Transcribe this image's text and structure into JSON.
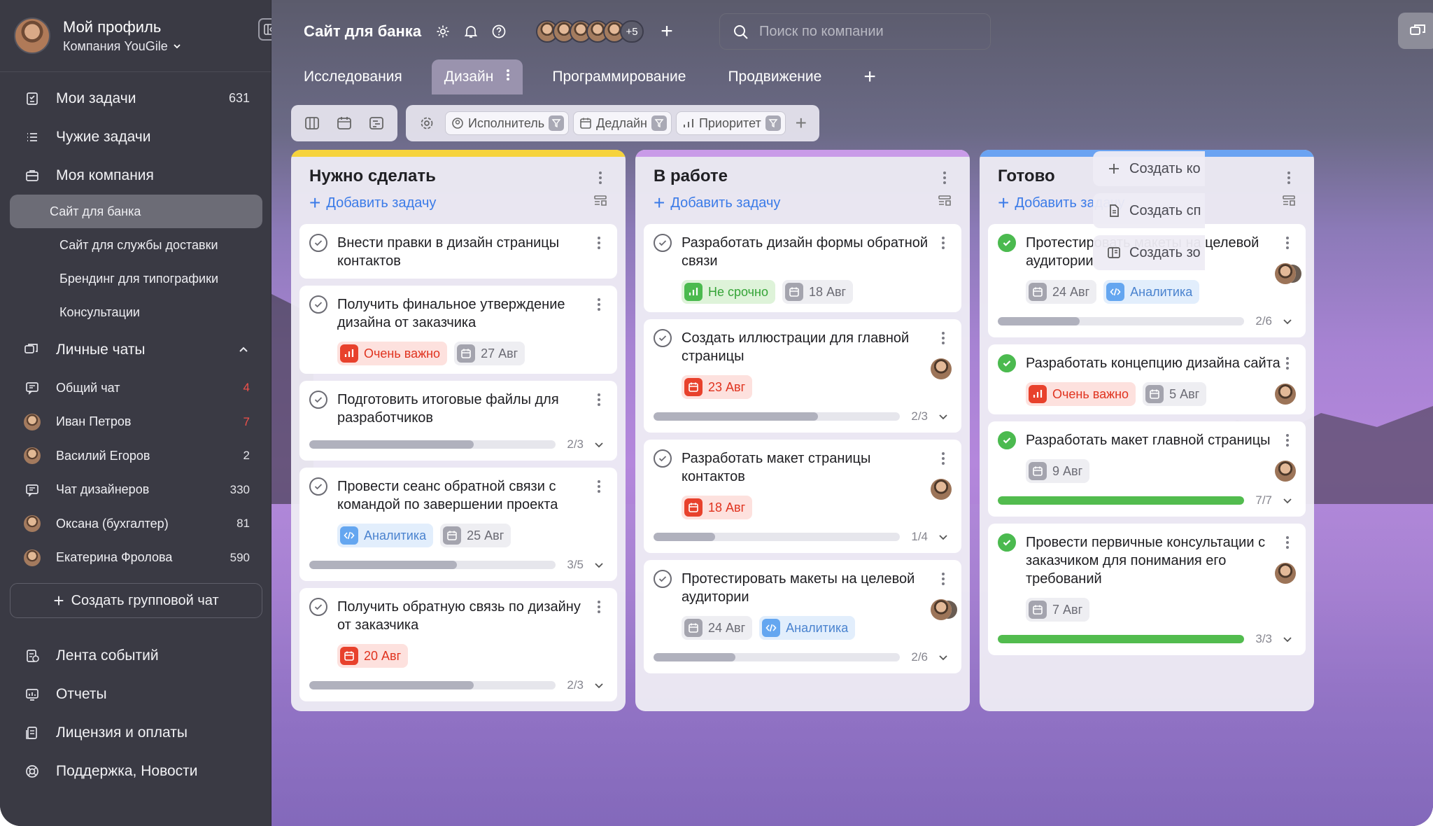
{
  "profile": {
    "name": "Мой профиль",
    "company": "Компания YouGile"
  },
  "nav": [
    {
      "label": "Мои задачи",
      "count": "631",
      "icon": "my-tasks-icon"
    },
    {
      "label": "Чужие задачи",
      "count": "",
      "icon": "list-icon"
    },
    {
      "label": "Моя компания",
      "count": "",
      "icon": "briefcase-icon"
    }
  ],
  "projects": [
    {
      "label": "Сайт для банка",
      "active": true
    },
    {
      "label": "Сайт для службы доставки"
    },
    {
      "label": "Брендинг для типографики"
    },
    {
      "label": "Консультации"
    }
  ],
  "chats_title": "Личные чаты",
  "chats": [
    {
      "label": "Общий чат",
      "count": "4",
      "red": true,
      "type": "chat"
    },
    {
      "label": "Иван Петров",
      "count": "7",
      "red": true,
      "type": "avatar"
    },
    {
      "label": "Василий Егоров",
      "count": "2",
      "type": "avatar"
    },
    {
      "label": "Чат дизайнеров",
      "count": "330",
      "type": "chat"
    },
    {
      "label": "Оксана (бухгалтер)",
      "count": "81",
      "type": "avatar"
    },
    {
      "label": "Екатерина Фролова",
      "count": "590",
      "type": "avatar"
    }
  ],
  "create_group": "Создать групповой чат",
  "bottom_nav": [
    {
      "label": "Лента событий",
      "icon": "events-icon"
    },
    {
      "label": "Отчеты",
      "icon": "reports-icon"
    },
    {
      "label": "Лицензия и оплаты",
      "icon": "license-icon"
    },
    {
      "label": "Поддержка, Новости",
      "icon": "support-icon"
    }
  ],
  "header": {
    "project_title": "Сайт для банка",
    "more_members": "+5",
    "search_placeholder": "Поиск по компании"
  },
  "tabs": [
    "Исследования",
    "Дизайн",
    "Программирование",
    "Продвижение"
  ],
  "filters": [
    "Исполнитель",
    "Дедлайн",
    "Приоритет"
  ],
  "add_task_label": "Добавить задачу",
  "columns": [
    {
      "title": "Нужно сделать",
      "stripe": "#f6d33c",
      "cards": [
        {
          "title": "Внести правки в дизайн страницы контактов",
          "done": false,
          "tags": [],
          "progress": null
        },
        {
          "title": "Получить финальное утверждение дизайна от заказчика",
          "done": false,
          "tags": [
            {
              "kind": "red",
              "icon": "priority-icon",
              "text": "Очень важно"
            },
            {
              "kind": "gray",
              "icon": "calendar-icon",
              "text": "27 Авг"
            }
          ],
          "progress": null
        },
        {
          "title": "Подготовить итоговые файлы для разработчиков",
          "done": false,
          "tags": [],
          "progress": {
            "text": "2/3",
            "value": 0.667
          }
        },
        {
          "title": "Провести сеанс обратной связи с командой по завершении проекта",
          "done": false,
          "tags": [
            {
              "kind": "blue",
              "icon": "code-icon",
              "text": "Аналитика"
            },
            {
              "kind": "gray",
              "icon": "calendar-icon",
              "text": "25 Авг"
            }
          ],
          "progress": {
            "text": "3/5",
            "value": 0.6
          }
        },
        {
          "title": "Получить обратную связь по дизайну от заказчика",
          "done": false,
          "tags": [
            {
              "kind": "red",
              "icon": "calendar-icon",
              "text": "20 Авг"
            }
          ],
          "progress": {
            "text": "2/3",
            "value": 0.667
          }
        }
      ]
    },
    {
      "title": "В работе",
      "stripe": "#c99be8",
      "cards": [
        {
          "title": "Разработать дизайн формы обратной связи",
          "done": false,
          "tags": [
            {
              "kind": "green",
              "icon": "priority-icon",
              "text": "Не срочно"
            },
            {
              "kind": "gray",
              "icon": "calendar-icon",
              "text": "18 Авг"
            }
          ],
          "progress": null
        },
        {
          "title": "Создать иллюстрации для главной страницы",
          "done": false,
          "tags": [
            {
              "kind": "red",
              "icon": "calendar-icon",
              "text": "23 Авг"
            }
          ],
          "avatar": true,
          "progress": {
            "text": "2/3",
            "value": 0.667
          }
        },
        {
          "title": "Разработать макет страницы контактов",
          "done": false,
          "tags": [
            {
              "kind": "red",
              "icon": "calendar-icon",
              "text": "18 Авг"
            }
          ],
          "avatar": true,
          "progress": {
            "text": "1/4",
            "value": 0.25
          }
        },
        {
          "title": "Протестировать макеты на целевой аудитории",
          "done": false,
          "tags": [
            {
              "kind": "gray",
              "icon": "calendar-icon",
              "text": "24 Авг"
            },
            {
              "kind": "blue",
              "icon": "code-icon",
              "text": "Аналитика"
            }
          ],
          "avatar": true,
          "duo": true,
          "progress": {
            "text": "2/6",
            "value": 0.333
          }
        }
      ]
    },
    {
      "title": "Готово",
      "stripe": "#6aa3f2",
      "cards": [
        {
          "title": "Протестировать макеты на целевой аудитории",
          "done": true,
          "tags": [
            {
              "kind": "gray",
              "icon": "calendar-icon",
              "text": "24 Авг"
            },
            {
              "kind": "blue",
              "icon": "code-icon",
              "text": "Аналитика"
            }
          ],
          "avatar": true,
          "duo": true,
          "progress": {
            "text": "2/6",
            "value": 0.333
          }
        },
        {
          "title": "Разработать концепцию дизайна сайта",
          "done": true,
          "tags": [
            {
              "kind": "red",
              "icon": "priority-icon",
              "text": "Очень важно"
            },
            {
              "kind": "gray",
              "icon": "calendar-icon",
              "text": "5 Авг"
            }
          ],
          "avatar": true,
          "progress": null
        },
        {
          "title": "Разработать макет главной страницы",
          "done": true,
          "tags": [
            {
              "kind": "gray",
              "icon": "calendar-icon",
              "text": "9 Авг"
            }
          ],
          "avatar": true,
          "progress": {
            "text": "7/7",
            "value": 1.0,
            "green": true
          }
        },
        {
          "title": "Провести первичные консультации с заказчиком для понимания его требований",
          "done": true,
          "tags": [
            {
              "kind": "gray",
              "icon": "calendar-icon",
              "text": "7 Авг"
            }
          ],
          "avatar": true,
          "progress": {
            "text": "3/3",
            "value": 1.0,
            "green": true
          }
        }
      ]
    }
  ],
  "side_actions": [
    {
      "label": "Создать ко",
      "icon": "plus-icon"
    },
    {
      "label": "Создать сп",
      "icon": "document-icon"
    },
    {
      "label": "Создать зо",
      "icon": "columns-icon"
    }
  ]
}
